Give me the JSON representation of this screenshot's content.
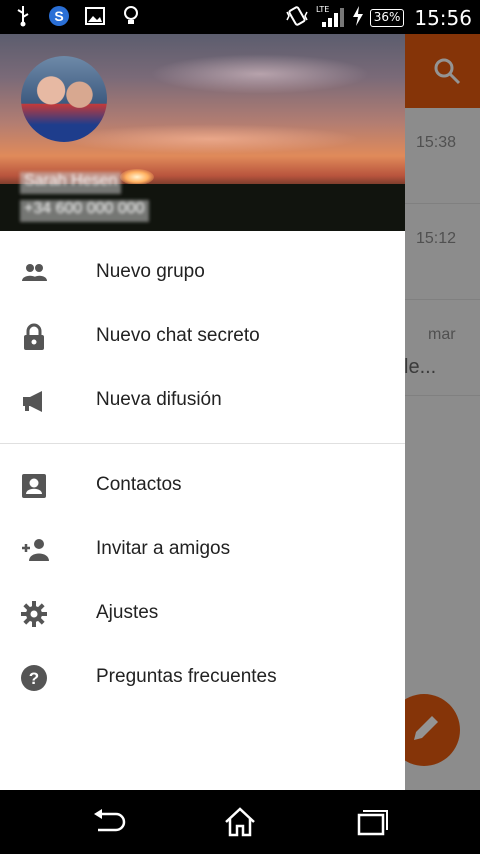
{
  "status_bar": {
    "icons_left": [
      "usb-icon",
      "skype-icon",
      "image-icon",
      "bulb-icon"
    ],
    "network": "LTE",
    "battery": "36%",
    "time": "15:56"
  },
  "background_app": {
    "rows": [
      {
        "time": "15:38",
        "fragment": ""
      },
      {
        "time": "15:12",
        "fragment": ""
      },
      {
        "time": "mar",
        "fragment": "le..."
      }
    ],
    "colors": {
      "accent": "#e65a0e"
    }
  },
  "drawer": {
    "header": {
      "name": "Sarah Hesen",
      "phone": "+34 600 000 000"
    },
    "menu_group_1": [
      {
        "label": "Nuevo grupo",
        "icon": "group-icon"
      },
      {
        "label": "Nuevo chat secreto",
        "icon": "lock-icon"
      },
      {
        "label": "Nueva difusión",
        "icon": "megaphone-icon"
      }
    ],
    "menu_group_2": [
      {
        "label": "Contactos",
        "icon": "contact-icon"
      },
      {
        "label": "Invitar a amigos",
        "icon": "person-add-icon"
      },
      {
        "label": "Ajustes",
        "icon": "gear-icon"
      },
      {
        "label": "Preguntas frecuentes",
        "icon": "help-icon"
      }
    ]
  },
  "nav_bar": {
    "buttons": [
      "back-icon",
      "home-icon",
      "recents-icon"
    ]
  }
}
